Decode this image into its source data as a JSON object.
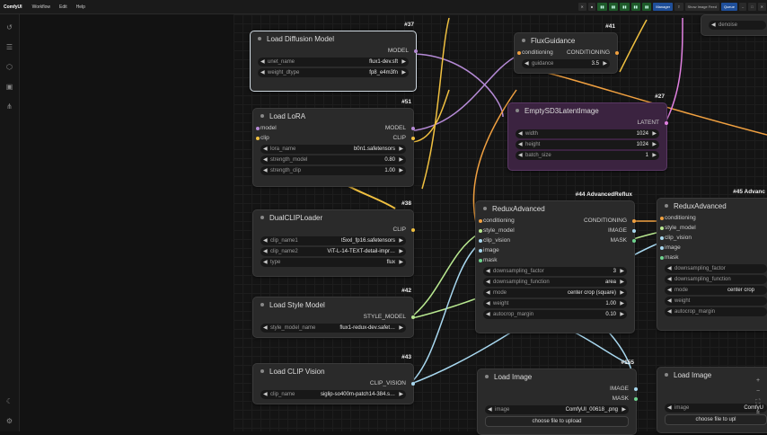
{
  "topbar": {
    "brand": "ComfyUI",
    "menus": [
      "Workflow",
      "Edit",
      "Help"
    ],
    "manager": "Manager",
    "feed": "Show Image Feed",
    "queue": "Queue"
  },
  "nodes": {
    "n37": {
      "id": "#37",
      "title": "Load Diffusion Model",
      "out": "MODEL",
      "w1l": "unet_name",
      "w1v": "flux1-dev.sft",
      "w2l": "weight_dtype",
      "w2v": "fp8_e4m3fn"
    },
    "n51": {
      "id": "#51",
      "title": "Load LoRA",
      "in1": "model",
      "in2": "clip",
      "out1": "MODEL",
      "out2": "CLIP",
      "w1l": "lora_name",
      "w1v": "b0n1.safetensors",
      "w2l": "strength_model",
      "w2v": "0.80",
      "w3l": "strength_clip",
      "w3v": "1.00"
    },
    "n38": {
      "id": "#38",
      "title": "DualCLIPLoader",
      "out": "CLIP",
      "w1l": "clip_name1",
      "w1v": "t5xxl_fp16.safetensors",
      "w2l": "clip_name2",
      "w2v": "ViT-L-14-TEXT-detail-impr…",
      "w3l": "type",
      "w3v": "flux"
    },
    "n42": {
      "id": "#42",
      "title": "Load Style Model",
      "out": "STYLE_MODEL",
      "w1l": "style_model_name",
      "w1v": "flux1-redux-dev.safet…"
    },
    "n43": {
      "id": "#43",
      "title": "Load CLIP Vision",
      "out": "CLIP_VISION",
      "w1l": "clip_name",
      "w1v": "siglip-so400m-patch14-384.s…"
    },
    "n41": {
      "id": "#41",
      "title": "FluxGuidance",
      "in1": "conditioning",
      "out1": "CONDITIONING",
      "w1l": "guidance",
      "w1v": "3.5"
    },
    "n27": {
      "id": "#27",
      "title": "EmptySD3LatentImage",
      "out": "LATENT",
      "w1l": "width",
      "w1v": "1024",
      "w2l": "height",
      "w2v": "1024",
      "w3l": "batch_size",
      "w3v": "1"
    },
    "n44": {
      "id": "#44 AdvancedReflux",
      "title": "ReduxAdvanced",
      "in1": "conditioning",
      "in2": "style_model",
      "in3": "clip_vision",
      "in4": "image",
      "in5": "mask",
      "out1": "CONDITIONING",
      "out2": "IMAGE",
      "out3": "MASK",
      "w1l": "downsampling_factor",
      "w1v": "3",
      "w2l": "downsampling_function",
      "w2v": "area",
      "w3l": "mode",
      "w3v": "center crop (square)",
      "w4l": "weight",
      "w4v": "1.00",
      "w5l": "autocrop_margin",
      "w5v": "0.10"
    },
    "n45": {
      "id": "#45 Advanc",
      "title": "ReduxAdvanced",
      "in1": "conditioning",
      "in2": "style_model",
      "in3": "clip_vision",
      "in4": "image",
      "in5": "mask",
      "w1l": "downsampling_factor",
      "w2l": "downsampling_function",
      "w3l": "mode",
      "w3v": "center crop",
      "w4l": "weight",
      "w5l": "autocrop_margin"
    },
    "n155": {
      "id": "#155",
      "title": "Load Image",
      "out1": "IMAGE",
      "out2": "MASK",
      "w1l": "image",
      "w1v": "ComfyUI_00618_.png",
      "upload": "choose file to upload"
    },
    "n156": {
      "title": "Load Image",
      "w1l": "image",
      "w1v": "ComfyU",
      "upload": "choose file to upl"
    },
    "denoise": {
      "label": "denoise"
    }
  }
}
